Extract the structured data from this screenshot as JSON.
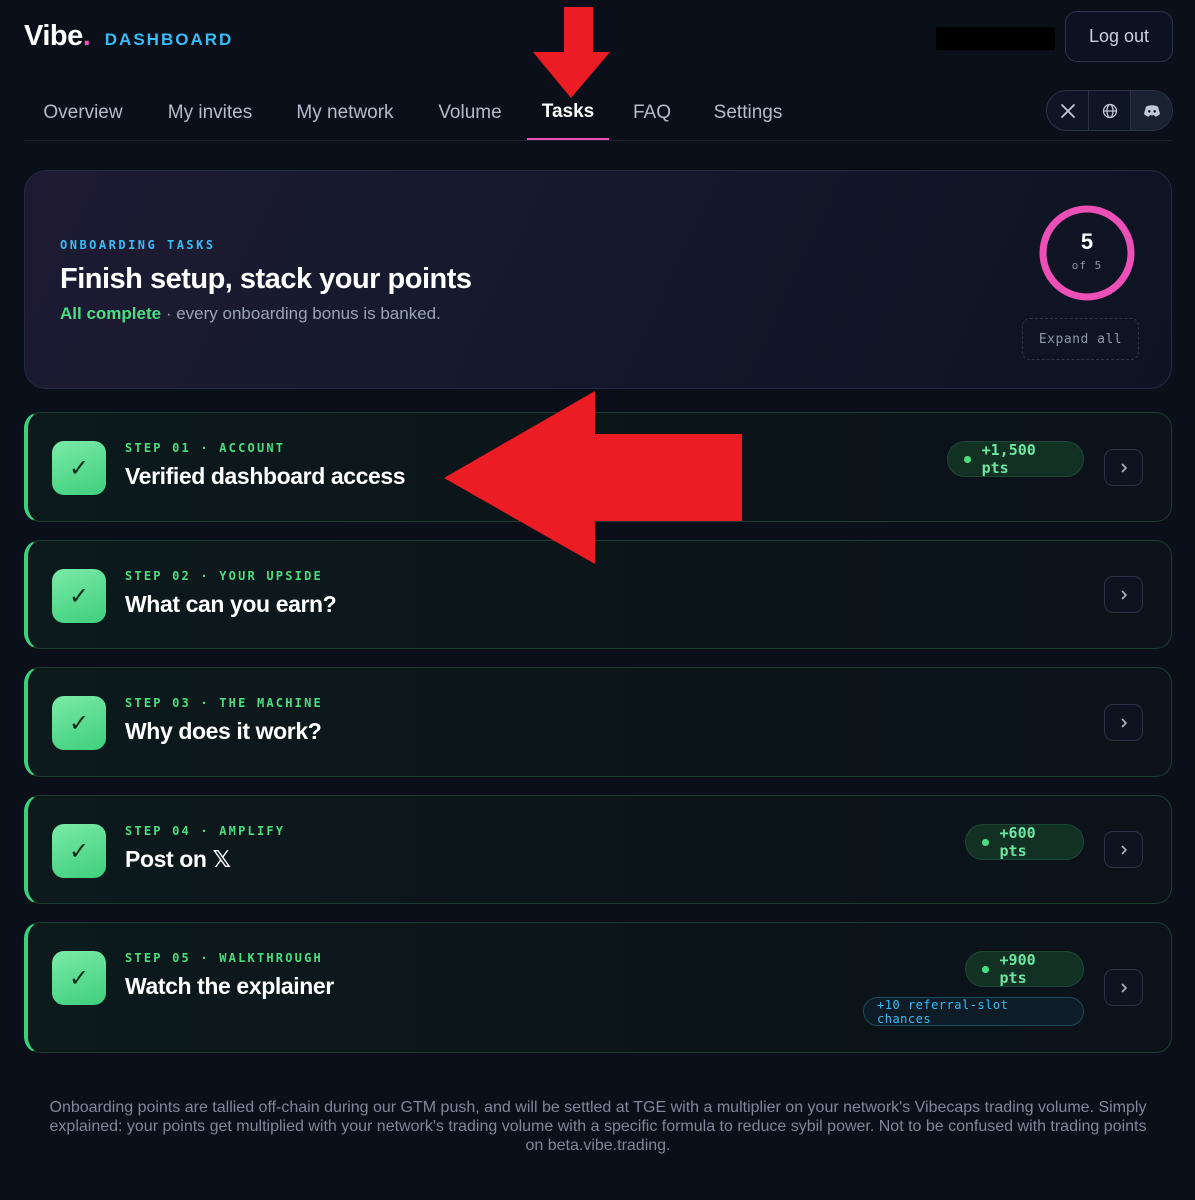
{
  "header": {
    "logo_text": "Vibe",
    "logo_dot": ".",
    "logo_sub": "DASHBOARD",
    "logout_label": "Log out"
  },
  "nav": {
    "tabs": [
      {
        "label": "Overview",
        "active": false
      },
      {
        "label": "My invites",
        "active": false
      },
      {
        "label": "My network",
        "active": false
      },
      {
        "label": "Volume",
        "active": false
      },
      {
        "label": "Tasks",
        "active": true
      },
      {
        "label": "FAQ",
        "active": false
      },
      {
        "label": "Settings",
        "active": false
      }
    ],
    "social_icons": [
      "x-icon",
      "globe-icon",
      "discord-icon"
    ]
  },
  "hero": {
    "kicker": "ONBOARDING TASKS",
    "title": "Finish setup, stack your points",
    "status_strong": "All complete",
    "status_rest": " · every onboarding bonus is banked.",
    "progress_done": "5",
    "progress_total_label": "of 5",
    "progress_fraction": 1.0,
    "expand_label": "Expand all"
  },
  "steps": [
    {
      "kicker": "STEP 01 · ACCOUNT",
      "title": "Verified dashboard access",
      "points": "+1,500 pts",
      "extra": ""
    },
    {
      "kicker": "STEP 02 · YOUR UPSIDE",
      "title": "What can you earn?",
      "points": "",
      "extra": ""
    },
    {
      "kicker": "STEP 03 · THE MACHINE",
      "title": "Why does it work?",
      "points": "",
      "extra": ""
    },
    {
      "kicker": "STEP 04 · AMPLIFY",
      "title": "Post on 𝕏",
      "points": "+600 pts",
      "extra": ""
    },
    {
      "kicker": "STEP 05 · WALKTHROUGH",
      "title": "Watch the explainer",
      "points": "+900 pts",
      "extra": "+10 referral-slot chances"
    }
  ],
  "check_glyph": "✓",
  "footer": {
    "line1": "Onboarding points are tallied off-chain during our GTM push, and will be settled at TGE with a multiplier on your network's Vibecaps trading volume. Simply",
    "line2": "explained: your points get multiplied with your network's trading volume with a specific formula to reduce sybil power. Not to be confused with trading points",
    "line3": "on beta.vibe.trading."
  },
  "colors": {
    "background": "#0a0f1a",
    "accent_pink": "#ec4fb6",
    "accent_blue": "#38bdf8",
    "success_green": "#4ade80",
    "annotation_red": "#ec1c24"
  }
}
